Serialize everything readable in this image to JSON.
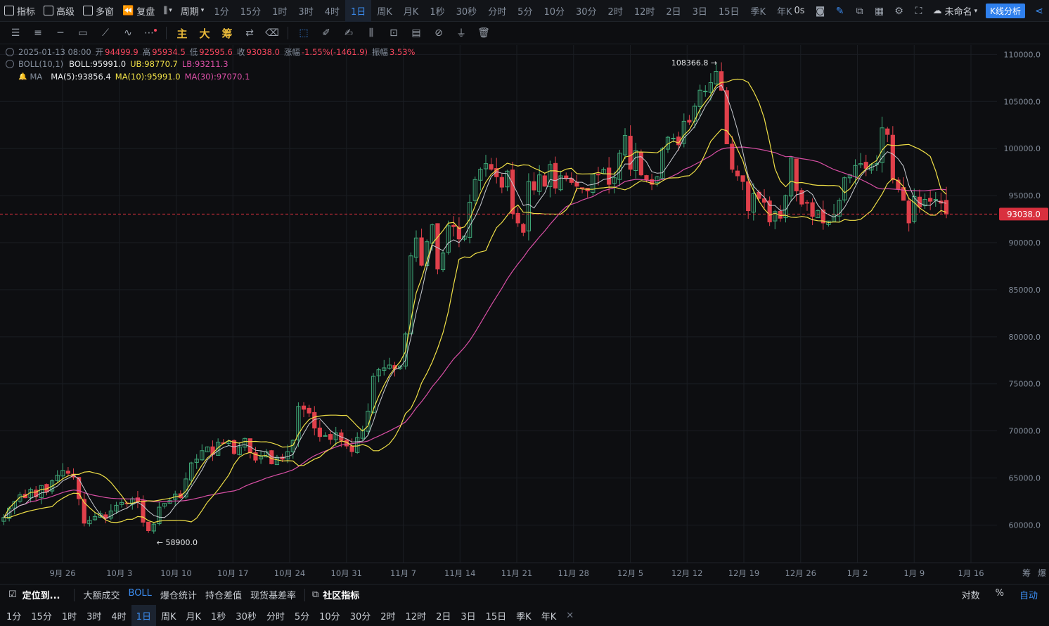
{
  "topbar": {
    "indicators": "指标",
    "advanced": "高级",
    "multiwin": "多窗",
    "replay": "复盘",
    "period": "周期",
    "timeframes": [
      "1分",
      "15分",
      "1时",
      "3时",
      "4时",
      "1日",
      "周K",
      "月K",
      "1秒",
      "30秒",
      "分时",
      "5分",
      "10分",
      "30分",
      "2时",
      "12时",
      "2日",
      "3日",
      "15日",
      "季K",
      "年K"
    ],
    "active_timeframe": "1日",
    "latency": "0s",
    "layout_name": "未命名",
    "kline_button": "K线分析"
  },
  "toolbar": {
    "main": "主",
    "big": "大",
    "chip": "筹"
  },
  "legend": {
    "ohlc": {
      "date": "2025-01-13 08:00",
      "open_label": "开",
      "open": "94499.9",
      "high_label": "高",
      "high": "95934.5",
      "low_label": "低",
      "low": "92595.6",
      "close_label": "收",
      "close": "93038.0",
      "change_label": "涨幅",
      "change": "-1.55%(-1461.9)",
      "amp_label": "振幅",
      "amp": "3.53%"
    },
    "boll": {
      "name": "BOLL(10,1)",
      "mid": "BOLL:95991.0",
      "ub": "UB:98770.7",
      "lb": "LB:93211.3"
    },
    "ma": {
      "name": "MA",
      "ma5": "MA(5):93856.4",
      "ma10": "MA(10):95991.0",
      "ma30": "MA(30):97070.1"
    }
  },
  "colors": {
    "up": "#2ebd85",
    "down": "#f6465d",
    "candle_up": "#3fa878",
    "candle_down": "#e0404b",
    "boll_mid": "#ffffff",
    "boll_band": "#f0e047",
    "ma30": "#d94fa5",
    "accent": "#2f80ed",
    "price_tag": "#d9303e"
  },
  "chart_data": {
    "type": "candlestick",
    "y_axis": {
      "min": 56000,
      "max": 111000,
      "ticks": [
        "110000.0",
        "105000.0",
        "100000.0",
        "95000.0",
        "90000.0",
        "85000.0",
        "80000.0",
        "75000.0",
        "70000.0",
        "65000.0",
        "60000.0"
      ]
    },
    "x_axis": {
      "ticks": [
        "9月 26",
        "10月 3",
        "10月 10",
        "10月 17",
        "10月 24",
        "10月 31",
        "11月 7",
        "11月 14",
        "11月 21",
        "11月 28",
        "12月 5",
        "12月 12",
        "12月 19",
        "12月 26",
        "1月 2",
        "1月 9",
        "1月 16"
      ]
    },
    "current_price": "93038.0",
    "high_marker": "108366.8",
    "low_marker": "58900.0",
    "axis_corner": [
      "筹",
      "爆"
    ],
    "closes": [
      60800,
      61800,
      62500,
      63200,
      62900,
      63800,
      63000,
      64200,
      63500,
      64700,
      65300,
      65800,
      65500,
      65100,
      62800,
      60200,
      60500,
      60900,
      61200,
      60700,
      61500,
      62100,
      62400,
      62300,
      62800,
      62500,
      60300,
      59400,
      60100,
      61900,
      62300,
      62600,
      63300,
      62900,
      64900,
      66600,
      67000,
      67900,
      68300,
      67500,
      68800,
      68700,
      68900,
      67600,
      68300,
      69200,
      67700,
      66900,
      67300,
      67800,
      66500,
      67200,
      67000,
      67800,
      69000,
      72600,
      72300,
      71900,
      70300,
      69400,
      69500,
      69100,
      69800,
      69000,
      68400,
      67800,
      69300,
      70100,
      72100,
      75800,
      76500,
      76700,
      77000,
      76600,
      76900,
      80300,
      88600,
      90500,
      87600,
      90100,
      91900,
      87200,
      88900,
      91800,
      91700,
      90400,
      90700,
      94300,
      96700,
      97800,
      98400,
      97800,
      97000,
      95900,
      97600,
      93100,
      92100,
      91100,
      96500,
      95600,
      97200,
      96000,
      98300,
      95800,
      97100,
      96800,
      96400,
      96000,
      95800,
      95500,
      97300,
      97200,
      97800,
      96200,
      96900,
      99500,
      101400,
      97800,
      99800,
      97200,
      96700,
      96200,
      97000,
      100000,
      101200,
      101100,
      100400,
      102900,
      102800,
      104500,
      106200,
      106100,
      107000,
      108200,
      106200,
      100500,
      97800,
      97100,
      96500,
      93400,
      95200,
      94700,
      94300,
      92200,
      93300,
      92600,
      95000,
      99000,
      95500,
      94100,
      94200,
      92800,
      93400,
      92100,
      92300,
      93000,
      94500,
      96900,
      97200,
      98200,
      98400,
      97900,
      98300,
      98400,
      102200,
      101500,
      96700,
      95700,
      94500,
      92100,
      94900,
      93800,
      94600,
      94400,
      94600,
      94200,
      93038
    ]
  },
  "bottom": {
    "locate": "定位到...",
    "tabs": [
      "大额成交",
      "BOLL",
      "爆仓统计",
      "持仓差值",
      "现货基差率"
    ],
    "active_tab": "BOLL",
    "community": "社区指标",
    "log": "对数",
    "percent": "%",
    "auto": "自动",
    "timeframes": [
      "1分",
      "15分",
      "1时",
      "3时",
      "4时",
      "1日",
      "周K",
      "月K",
      "1秒",
      "30秒",
      "分时",
      "5分",
      "10分",
      "30分",
      "2时",
      "12时",
      "2日",
      "3日",
      "15日",
      "季K",
      "年K"
    ],
    "active_timeframe": "1日"
  }
}
